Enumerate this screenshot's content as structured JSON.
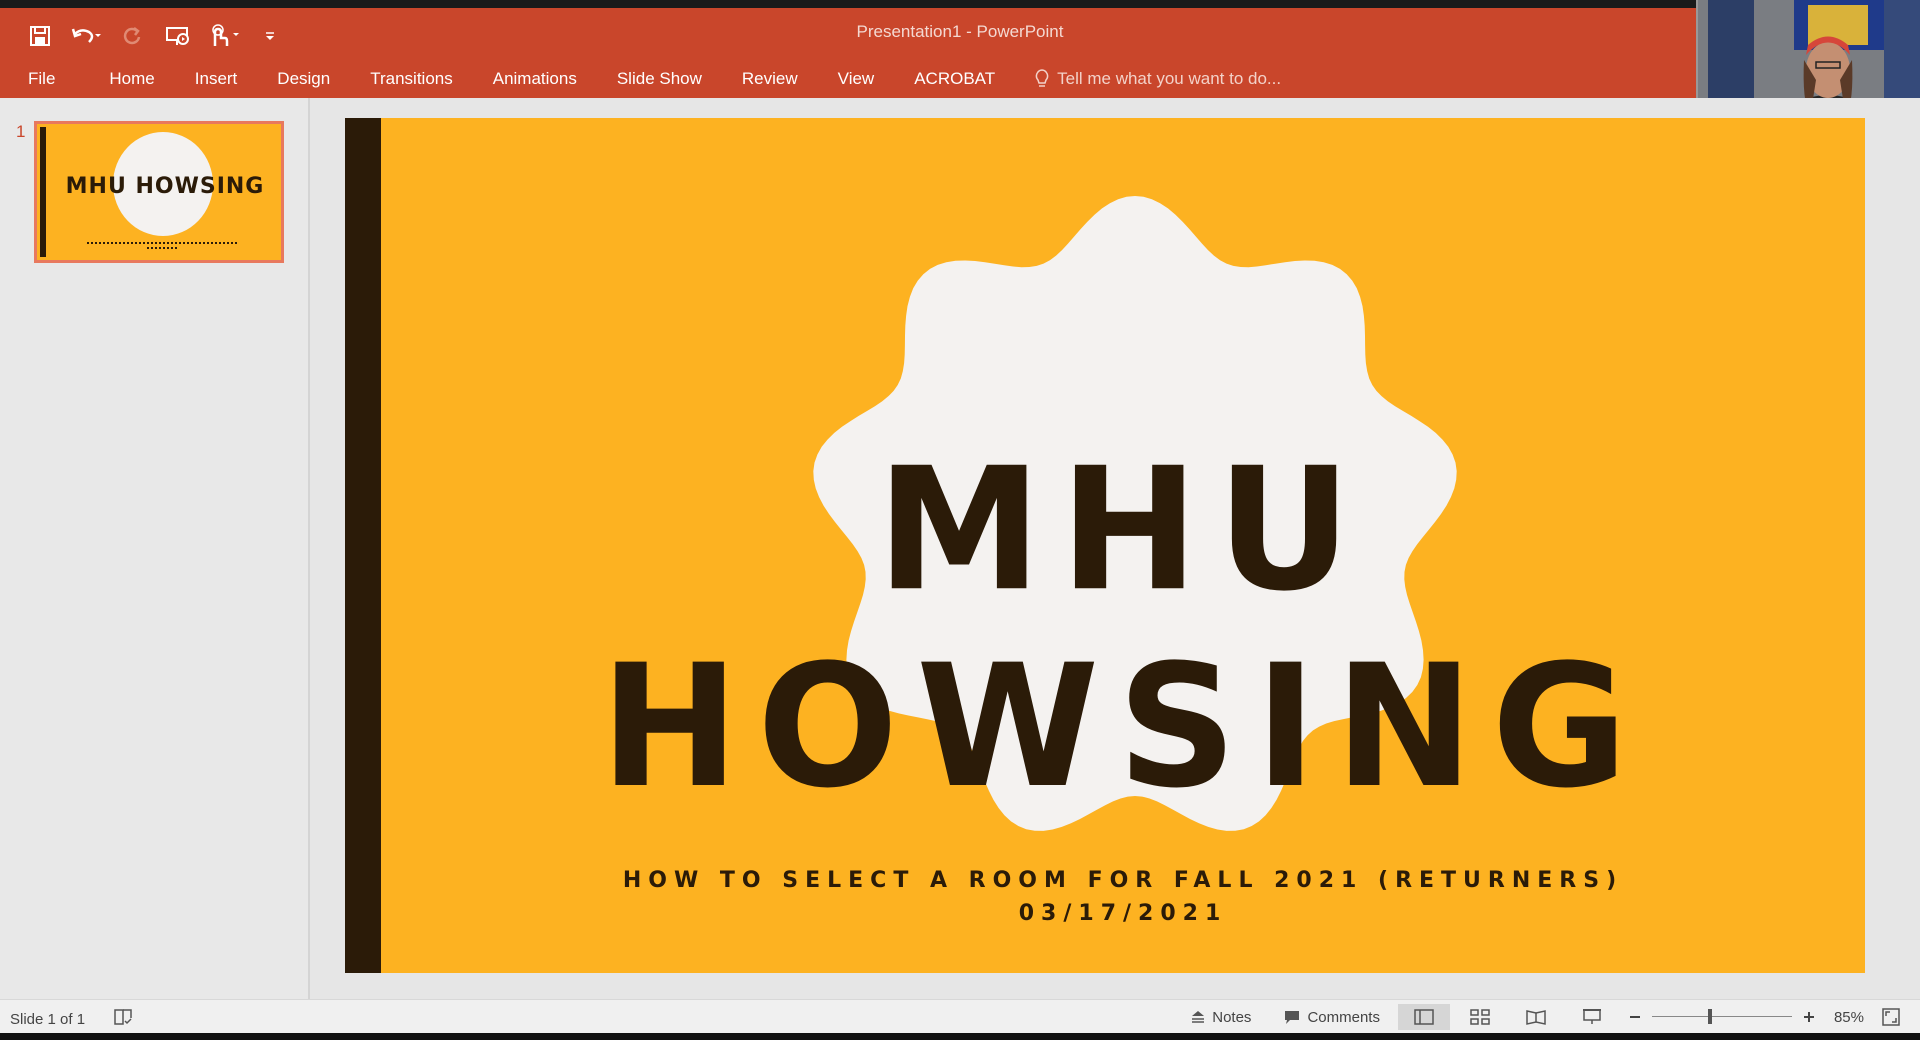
{
  "window": {
    "title": "Presentation1 - PowerPoint"
  },
  "quick_access": {
    "icons": [
      "save-icon",
      "undo-icon",
      "redo-icon",
      "present-from-start-icon",
      "touch-mode-icon",
      "customize-icon"
    ]
  },
  "ribbon": {
    "tabs": [
      {
        "label": "File"
      },
      {
        "label": "Home"
      },
      {
        "label": "Insert"
      },
      {
        "label": "Design"
      },
      {
        "label": "Transitions"
      },
      {
        "label": "Animations"
      },
      {
        "label": "Slide Show"
      },
      {
        "label": "Review"
      },
      {
        "label": "View"
      },
      {
        "label": "ACROBAT"
      }
    ],
    "tell_me": "Tell me what you want to do..."
  },
  "thumbnails": [
    {
      "number": "1",
      "title": "MHU HOWSING"
    }
  ],
  "slide": {
    "title": "MHU HOWSING",
    "subtitle_line1": "HOW TO SELECT A ROOM FOR FALL 2021 (RETURNERS)",
    "subtitle_line2": "03/17/2021"
  },
  "status": {
    "slide_info": "Slide 1 of 1",
    "notes_label": "Notes",
    "comments_label": "Comments",
    "zoom_label": "85%",
    "zoom_percent": 85
  },
  "colors": {
    "ribbon": "#c9462b",
    "slide_background": "#fdb221",
    "slide_dark": "#2b1b08",
    "shape_fill": "#f4f2f0"
  }
}
